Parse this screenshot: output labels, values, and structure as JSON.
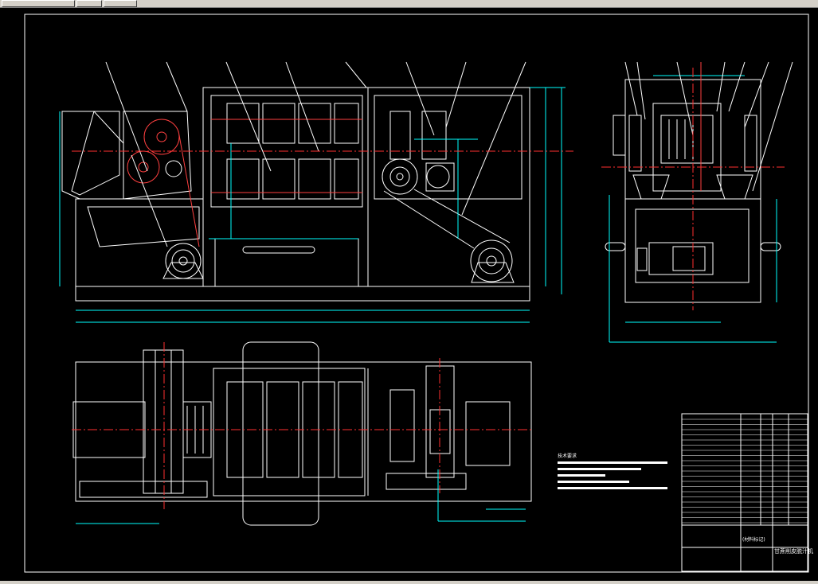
{
  "window": {
    "title_bar_label": "",
    "toolbar_buttons": [
      "",
      "",
      ""
    ]
  },
  "drawing": {
    "notes_title": "技术要求",
    "title_block": {
      "material_label": "(材料标记)",
      "drawing_name": "甘蔗削皮脱汁机"
    }
  },
  "colors": {
    "background": "#000000",
    "outline": "#ffffff",
    "dimension": "#00ffff",
    "centerline": "#ff3030",
    "section": "#ff4040"
  }
}
